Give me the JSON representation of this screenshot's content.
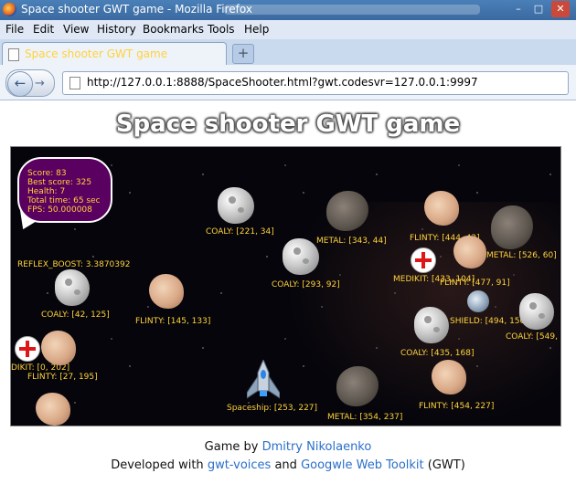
{
  "window": {
    "title": "Space shooter GWT game - Mozilla Firefox",
    "min": "–",
    "max": "□",
    "close": "✕"
  },
  "menu": [
    "File",
    "Edit",
    "View",
    "History",
    "Bookmarks",
    "Tools",
    "Help"
  ],
  "tab": {
    "label": "Space shooter GWT game",
    "new_tab": "+"
  },
  "nav": {
    "url": "http://127.0.0.1:8888/SpaceShooter.html?gwt.codesvr=127.0.0.1:9997",
    "back_glyph": "←",
    "forward_glyph": "→"
  },
  "page": {
    "title": "Space shooter GWT game"
  },
  "hud": {
    "score": "Score: 83",
    "best": "Best score: 325",
    "health": "Health: 7",
    "time": "Total time: 65 sec",
    "fps": "FPS: 50.000008"
  },
  "labels": {
    "coaly1": "COALY: [221, 34]",
    "metal1": "METAL: [343, 44]",
    "flinty1": "FLINTY: [444, 42]",
    "metal2": "METAL: [526, 60]",
    "medikit1": "MEDIKIT: [433, 104]",
    "flinty2": "FLINTY: [477, 91]",
    "reflex": "REFLEX_BOOST: 3.3870392",
    "coaly2": "COALY: [293, 92]",
    "coaly3": "COALY: [42, 125]",
    "flinty3": "FLINTY: [145, 133]",
    "shield": "SHIELD: [494, 150]",
    "coaly4": "COALY: [549,",
    "coaly5": "COALY: [435, 168]",
    "medikit2": "DIKIT: [0, 202]",
    "flinty4": "FLINTY: [27, 195]",
    "ship": "Spaceship: [253, 227]",
    "metal3": "METAL: [354, 237]",
    "flinty5": "FLINTY: [454, 227]"
  },
  "footer": {
    "line1_prefix": "Game by ",
    "author": "Dmitry Nikolaenko",
    "line2_prefix": "Developed with ",
    "lib1": "gwt-voices",
    "and": " and ",
    "lib2": "Googwle Web Toolkit",
    "suffix": " (GWT)"
  }
}
